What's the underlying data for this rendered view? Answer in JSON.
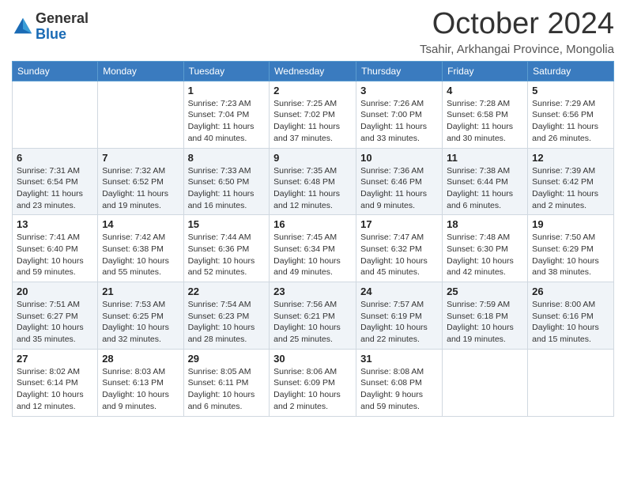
{
  "header": {
    "logo_general": "General",
    "logo_blue": "Blue",
    "month_title": "October 2024",
    "subtitle": "Tsahir, Arkhangai Province, Mongolia"
  },
  "calendar": {
    "days_of_week": [
      "Sunday",
      "Monday",
      "Tuesday",
      "Wednesday",
      "Thursday",
      "Friday",
      "Saturday"
    ],
    "weeks": [
      [
        {
          "day": "",
          "info": ""
        },
        {
          "day": "",
          "info": ""
        },
        {
          "day": "1",
          "sunrise": "Sunrise: 7:23 AM",
          "sunset": "Sunset: 7:04 PM",
          "daylight": "Daylight: 11 hours and 40 minutes."
        },
        {
          "day": "2",
          "sunrise": "Sunrise: 7:25 AM",
          "sunset": "Sunset: 7:02 PM",
          "daylight": "Daylight: 11 hours and 37 minutes."
        },
        {
          "day": "3",
          "sunrise": "Sunrise: 7:26 AM",
          "sunset": "Sunset: 7:00 PM",
          "daylight": "Daylight: 11 hours and 33 minutes."
        },
        {
          "day": "4",
          "sunrise": "Sunrise: 7:28 AM",
          "sunset": "Sunset: 6:58 PM",
          "daylight": "Daylight: 11 hours and 30 minutes."
        },
        {
          "day": "5",
          "sunrise": "Sunrise: 7:29 AM",
          "sunset": "Sunset: 6:56 PM",
          "daylight": "Daylight: 11 hours and 26 minutes."
        }
      ],
      [
        {
          "day": "6",
          "sunrise": "Sunrise: 7:31 AM",
          "sunset": "Sunset: 6:54 PM",
          "daylight": "Daylight: 11 hours and 23 minutes."
        },
        {
          "day": "7",
          "sunrise": "Sunrise: 7:32 AM",
          "sunset": "Sunset: 6:52 PM",
          "daylight": "Daylight: 11 hours and 19 minutes."
        },
        {
          "day": "8",
          "sunrise": "Sunrise: 7:33 AM",
          "sunset": "Sunset: 6:50 PM",
          "daylight": "Daylight: 11 hours and 16 minutes."
        },
        {
          "day": "9",
          "sunrise": "Sunrise: 7:35 AM",
          "sunset": "Sunset: 6:48 PM",
          "daylight": "Daylight: 11 hours and 12 minutes."
        },
        {
          "day": "10",
          "sunrise": "Sunrise: 7:36 AM",
          "sunset": "Sunset: 6:46 PM",
          "daylight": "Daylight: 11 hours and 9 minutes."
        },
        {
          "day": "11",
          "sunrise": "Sunrise: 7:38 AM",
          "sunset": "Sunset: 6:44 PM",
          "daylight": "Daylight: 11 hours and 6 minutes."
        },
        {
          "day": "12",
          "sunrise": "Sunrise: 7:39 AM",
          "sunset": "Sunset: 6:42 PM",
          "daylight": "Daylight: 11 hours and 2 minutes."
        }
      ],
      [
        {
          "day": "13",
          "sunrise": "Sunrise: 7:41 AM",
          "sunset": "Sunset: 6:40 PM",
          "daylight": "Daylight: 10 hours and 59 minutes."
        },
        {
          "day": "14",
          "sunrise": "Sunrise: 7:42 AM",
          "sunset": "Sunset: 6:38 PM",
          "daylight": "Daylight: 10 hours and 55 minutes."
        },
        {
          "day": "15",
          "sunrise": "Sunrise: 7:44 AM",
          "sunset": "Sunset: 6:36 PM",
          "daylight": "Daylight: 10 hours and 52 minutes."
        },
        {
          "day": "16",
          "sunrise": "Sunrise: 7:45 AM",
          "sunset": "Sunset: 6:34 PM",
          "daylight": "Daylight: 10 hours and 49 minutes."
        },
        {
          "day": "17",
          "sunrise": "Sunrise: 7:47 AM",
          "sunset": "Sunset: 6:32 PM",
          "daylight": "Daylight: 10 hours and 45 minutes."
        },
        {
          "day": "18",
          "sunrise": "Sunrise: 7:48 AM",
          "sunset": "Sunset: 6:30 PM",
          "daylight": "Daylight: 10 hours and 42 minutes."
        },
        {
          "day": "19",
          "sunrise": "Sunrise: 7:50 AM",
          "sunset": "Sunset: 6:29 PM",
          "daylight": "Daylight: 10 hours and 38 minutes."
        }
      ],
      [
        {
          "day": "20",
          "sunrise": "Sunrise: 7:51 AM",
          "sunset": "Sunset: 6:27 PM",
          "daylight": "Daylight: 10 hours and 35 minutes."
        },
        {
          "day": "21",
          "sunrise": "Sunrise: 7:53 AM",
          "sunset": "Sunset: 6:25 PM",
          "daylight": "Daylight: 10 hours and 32 minutes."
        },
        {
          "day": "22",
          "sunrise": "Sunrise: 7:54 AM",
          "sunset": "Sunset: 6:23 PM",
          "daylight": "Daylight: 10 hours and 28 minutes."
        },
        {
          "day": "23",
          "sunrise": "Sunrise: 7:56 AM",
          "sunset": "Sunset: 6:21 PM",
          "daylight": "Daylight: 10 hours and 25 minutes."
        },
        {
          "day": "24",
          "sunrise": "Sunrise: 7:57 AM",
          "sunset": "Sunset: 6:19 PM",
          "daylight": "Daylight: 10 hours and 22 minutes."
        },
        {
          "day": "25",
          "sunrise": "Sunrise: 7:59 AM",
          "sunset": "Sunset: 6:18 PM",
          "daylight": "Daylight: 10 hours and 19 minutes."
        },
        {
          "day": "26",
          "sunrise": "Sunrise: 8:00 AM",
          "sunset": "Sunset: 6:16 PM",
          "daylight": "Daylight: 10 hours and 15 minutes."
        }
      ],
      [
        {
          "day": "27",
          "sunrise": "Sunrise: 8:02 AM",
          "sunset": "Sunset: 6:14 PM",
          "daylight": "Daylight: 10 hours and 12 minutes."
        },
        {
          "day": "28",
          "sunrise": "Sunrise: 8:03 AM",
          "sunset": "Sunset: 6:13 PM",
          "daylight": "Daylight: 10 hours and 9 minutes."
        },
        {
          "day": "29",
          "sunrise": "Sunrise: 8:05 AM",
          "sunset": "Sunset: 6:11 PM",
          "daylight": "Daylight: 10 hours and 6 minutes."
        },
        {
          "day": "30",
          "sunrise": "Sunrise: 8:06 AM",
          "sunset": "Sunset: 6:09 PM",
          "daylight": "Daylight: 10 hours and 2 minutes."
        },
        {
          "day": "31",
          "sunrise": "Sunrise: 8:08 AM",
          "sunset": "Sunset: 6:08 PM",
          "daylight": "Daylight: 9 hours and 59 minutes."
        },
        {
          "day": "",
          "info": ""
        },
        {
          "day": "",
          "info": ""
        }
      ]
    ]
  }
}
